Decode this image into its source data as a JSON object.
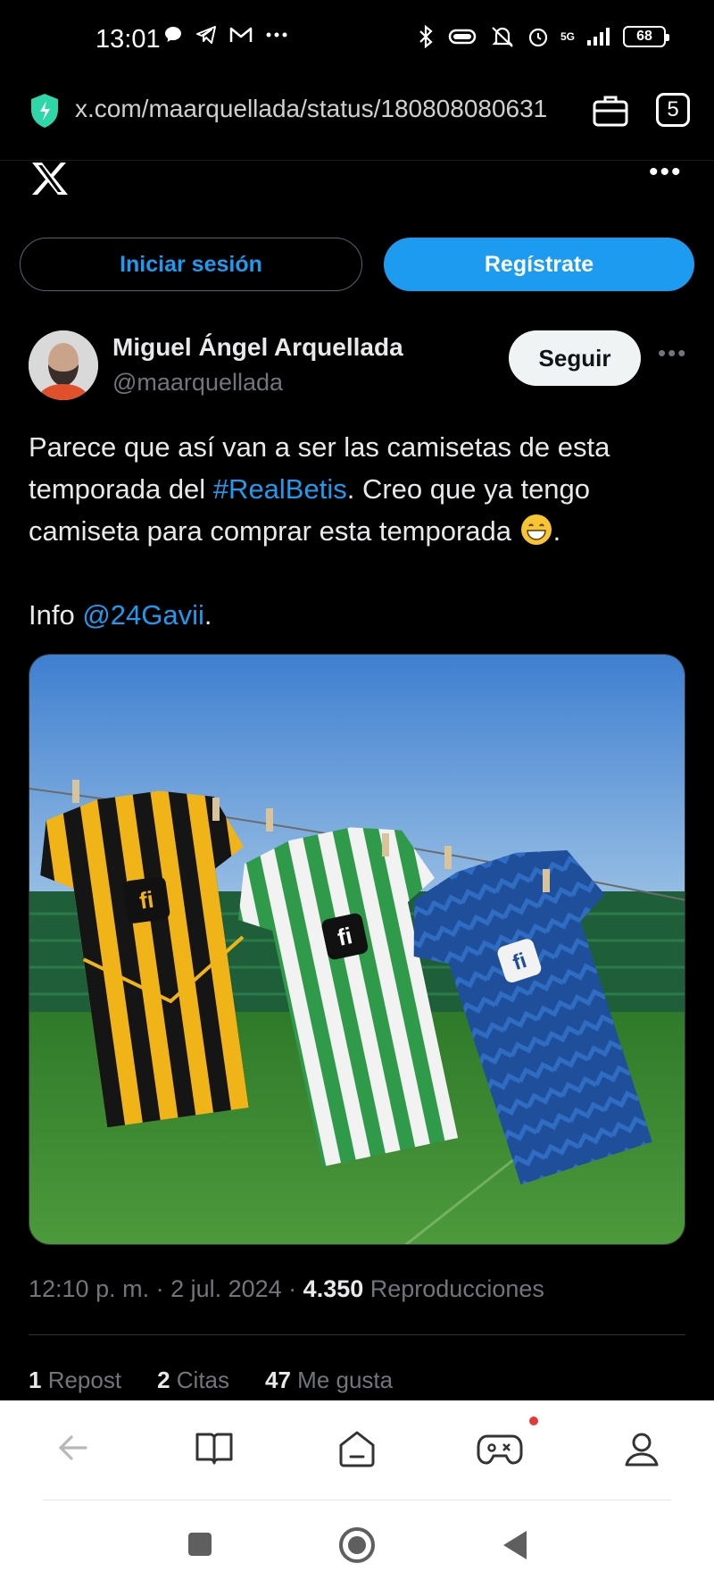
{
  "status_bar": {
    "time": "13:01",
    "network": "5G",
    "battery": "68"
  },
  "browser": {
    "url": "x.com/maarquellada/status/180808080631",
    "tab_count": "5"
  },
  "auth": {
    "login_label": "Iniciar sesión",
    "signup_label": "Regístrate"
  },
  "tweet": {
    "author_name": "Miguel Ángel Arquellada",
    "author_handle": "@maarquellada",
    "follow_label": "Seguir",
    "text_part1": "Parece que así van a ser las camisetas de esta temporada del ",
    "hashtag": "#RealBetis",
    "text_part2": ". Creo que ya tengo camiseta para comprar esta temporada ",
    "text_part3": ".",
    "info_prefix": "Info ",
    "mention": "@24Gavii",
    "info_suffix": ".",
    "image_alt": "finetwork",
    "timestamp": "12:10 p. m. · 2 jul. 2024 · ",
    "views_count": "4.350",
    "views_label": " Reproducciones",
    "reposts_count": "1",
    "reposts_label": " Repost",
    "quotes_count": "2",
    "quotes_label": " Citas",
    "likes_count": "47",
    "likes_label": " Me gusta"
  },
  "colors": {
    "accent": "#1d9bf0",
    "background": "#000000",
    "text": "#e7e9ea",
    "muted": "#71767b"
  }
}
